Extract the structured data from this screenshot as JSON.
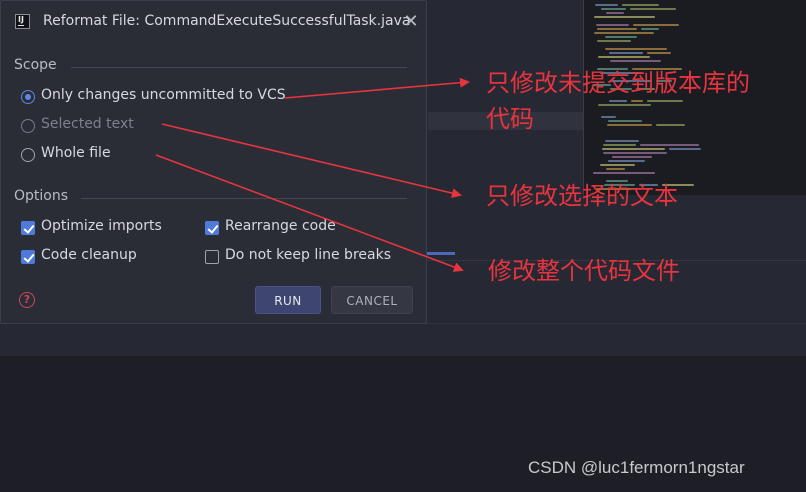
{
  "dialog": {
    "app_icon_text": "IJ",
    "title": "Reformat File: CommandExecuteSuccessfulTask.java",
    "close_symbol": "✕"
  },
  "scope": {
    "label": "Scope",
    "options": [
      {
        "label": "Only changes uncommitted to VCS",
        "checked": true,
        "enabled": true
      },
      {
        "label": "Selected text",
        "checked": false,
        "enabled": false
      },
      {
        "label": "Whole file",
        "checked": false,
        "enabled": true
      }
    ]
  },
  "options": {
    "label": "Options",
    "items": [
      {
        "label": "Optimize imports",
        "checked": true
      },
      {
        "label": "Rearrange code",
        "checked": true
      },
      {
        "label": "Code cleanup",
        "checked": true
      },
      {
        "label": "Do not keep line breaks",
        "checked": false
      }
    ]
  },
  "buttons": {
    "help_symbol": "?",
    "run": "RUN",
    "cancel": "CANCEL"
  },
  "annotations": {
    "vcs_line1": "只修改未提交到版本库的",
    "vcs_line2": "代码",
    "selected": "只修改选择的文本",
    "whole": "修改整个代码文件"
  },
  "watermark": "CSDN @luc1fermorn1ngstar",
  "colors": {
    "annotation": "#e8343e",
    "accent": "#4f7ad9",
    "dialog_bg": "#2b2d36",
    "help": "#c9485a"
  }
}
